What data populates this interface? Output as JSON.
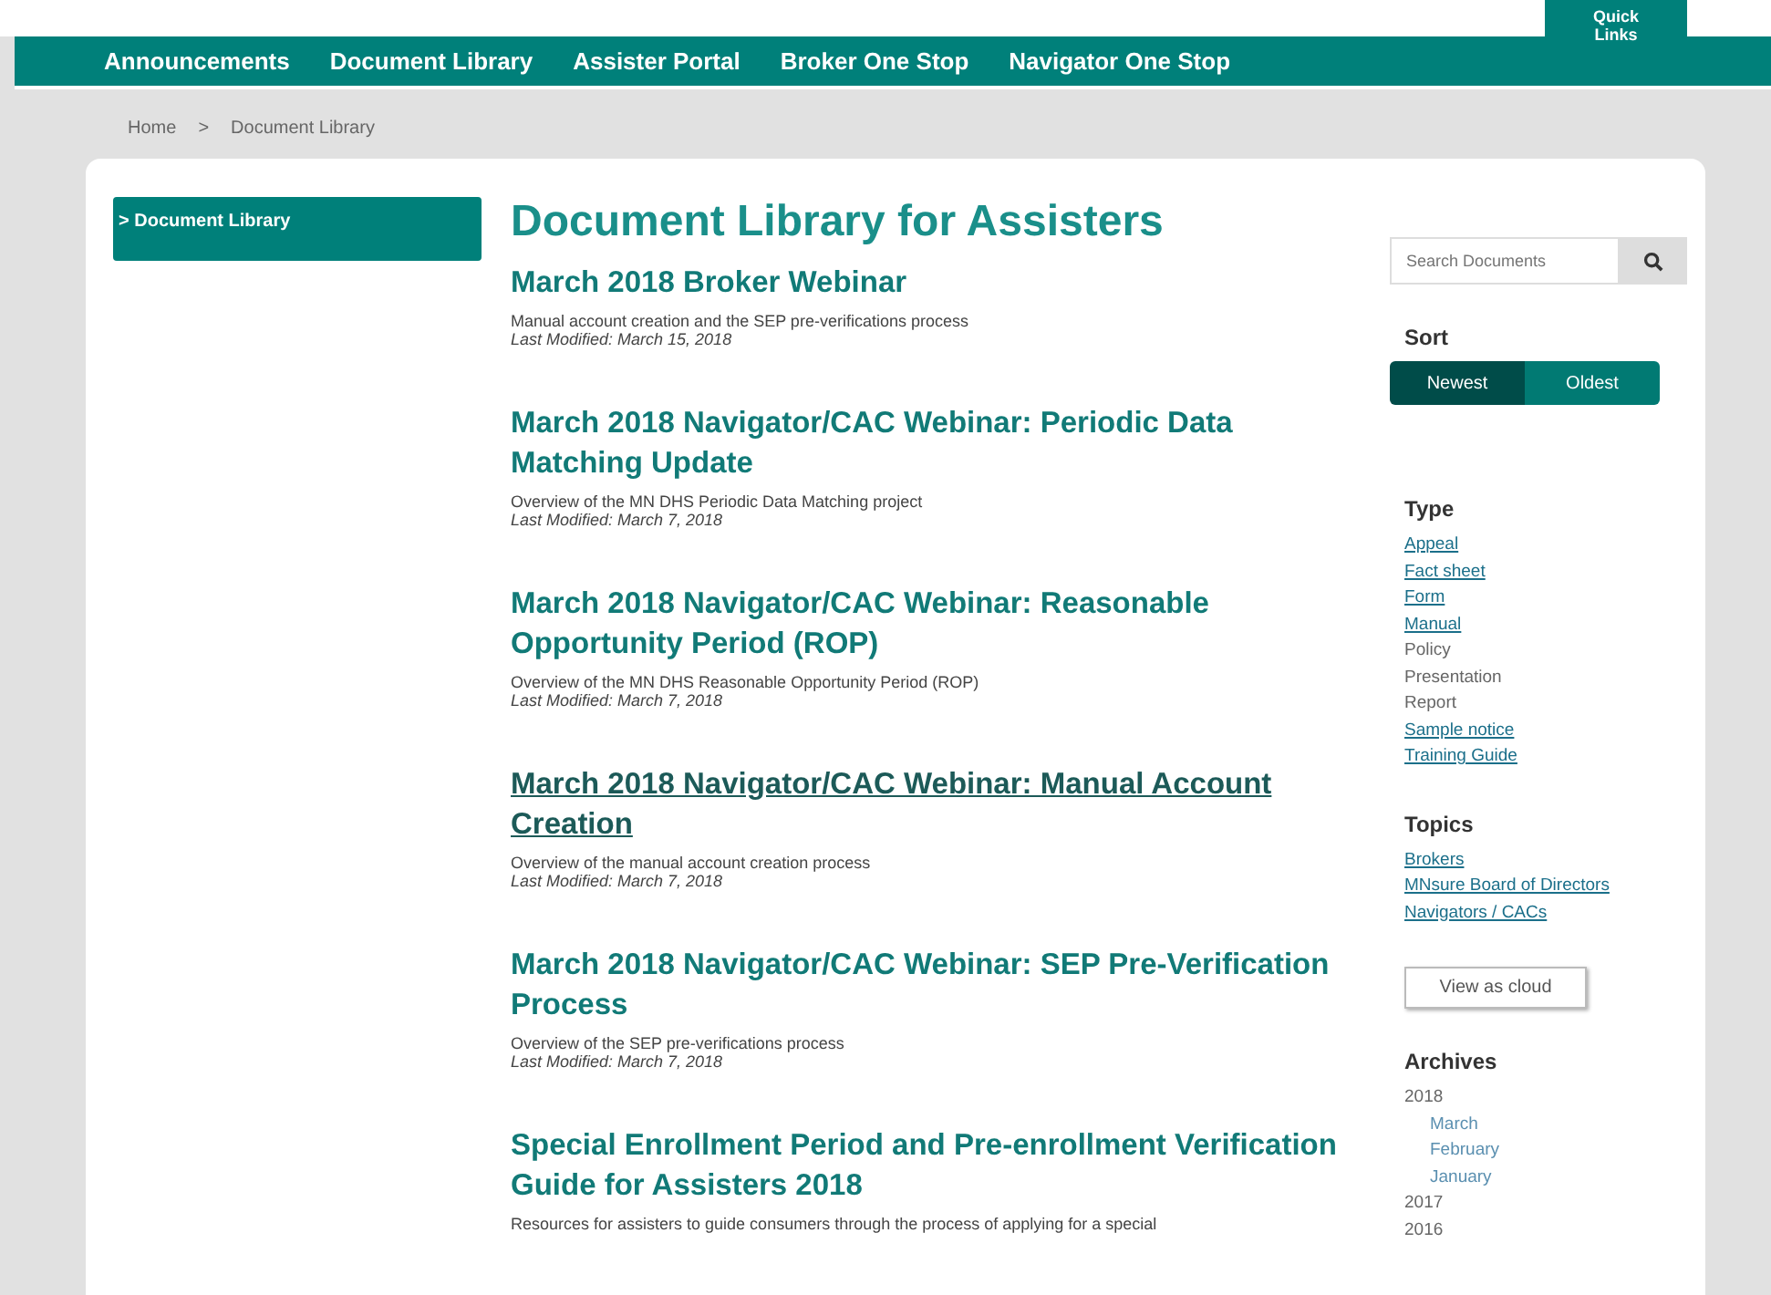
{
  "quick_links": "Quick Links",
  "nav": [
    "Announcements",
    "Document Library",
    "Assister Portal",
    "Broker One Stop",
    "Navigator One Stop"
  ],
  "breadcrumb": [
    "Home",
    ">",
    "Document Library"
  ],
  "sidebar": {
    "items": [
      {
        "label": "> Document Library",
        "selected": true
      }
    ]
  },
  "title": "Document Library for Assisters",
  "documents": [
    {
      "title": "March 2018 Broker Webinar",
      "description": "Manual account creation and the SEP pre-verifications process",
      "modified": "Last Modified: March 15, 2018",
      "hovered": false
    },
    {
      "title": "March 2018 Navigator/CAC Webinar: Periodic Data Matching Update",
      "description": "Overview of the MN DHS Periodic Data Matching project",
      "modified": "Last Modified: March 7, 2018",
      "hovered": false
    },
    {
      "title": "March 2018 Navigator/CAC Webinar: Reasonable Opportunity Period (ROP)",
      "description": "Overview of the MN DHS Reasonable Opportunity Period (ROP)",
      "modified": "Last Modified: March 7, 2018",
      "hovered": false
    },
    {
      "title": "March 2018 Navigator/CAC Webinar: Manual Account Creation",
      "description": "Overview of the manual account creation process",
      "modified": "Last Modified: March 7, 2018",
      "hovered": true
    },
    {
      "title": "March 2018 Navigator/CAC Webinar: SEP Pre-Verification Process",
      "description": "Overview of the SEP pre-verifications process",
      "modified": "Last Modified: March 7, 2018",
      "hovered": false
    },
    {
      "title": "Special Enrollment Period and Pre-enrollment Verification Guide for Assisters 2018",
      "description": "Resources for assisters to guide consumers through the process of applying for a special",
      "hovered": false
    }
  ],
  "search": {
    "placeholder": "Search Documents"
  },
  "sort": {
    "heading": "Sort",
    "options": [
      {
        "label": "Newest",
        "selected": true
      },
      {
        "label": "Oldest",
        "selected": false
      }
    ]
  },
  "type": {
    "heading": "Type",
    "items": [
      {
        "label": "Appeal",
        "kind": "link"
      },
      {
        "label": "Fact sheet",
        "kind": "link"
      },
      {
        "label": "Form",
        "kind": "link"
      },
      {
        "label": "Manual",
        "kind": "link"
      },
      {
        "label": "Policy",
        "kind": "plain"
      },
      {
        "label": "Presentation",
        "kind": "plain"
      },
      {
        "label": "Report",
        "kind": "plain"
      },
      {
        "label": "Sample notice",
        "kind": "link"
      },
      {
        "label": "Training Guide",
        "kind": "link"
      }
    ]
  },
  "topics": {
    "heading": "Topics",
    "items": [
      {
        "label": "Brokers",
        "kind": "link"
      },
      {
        "label": "MNsure Board of Directors",
        "kind": "link"
      },
      {
        "label": "Navigators / CACs",
        "kind": "link"
      }
    ]
  },
  "cloud_button": "View as cloud",
  "archives": {
    "heading": "Archives",
    "items": [
      {
        "label": "2018",
        "children": [
          {
            "label": "March"
          },
          {
            "label": "February"
          },
          {
            "label": "January"
          }
        ]
      },
      {
        "label": "2017"
      },
      {
        "label": "2016"
      }
    ]
  }
}
